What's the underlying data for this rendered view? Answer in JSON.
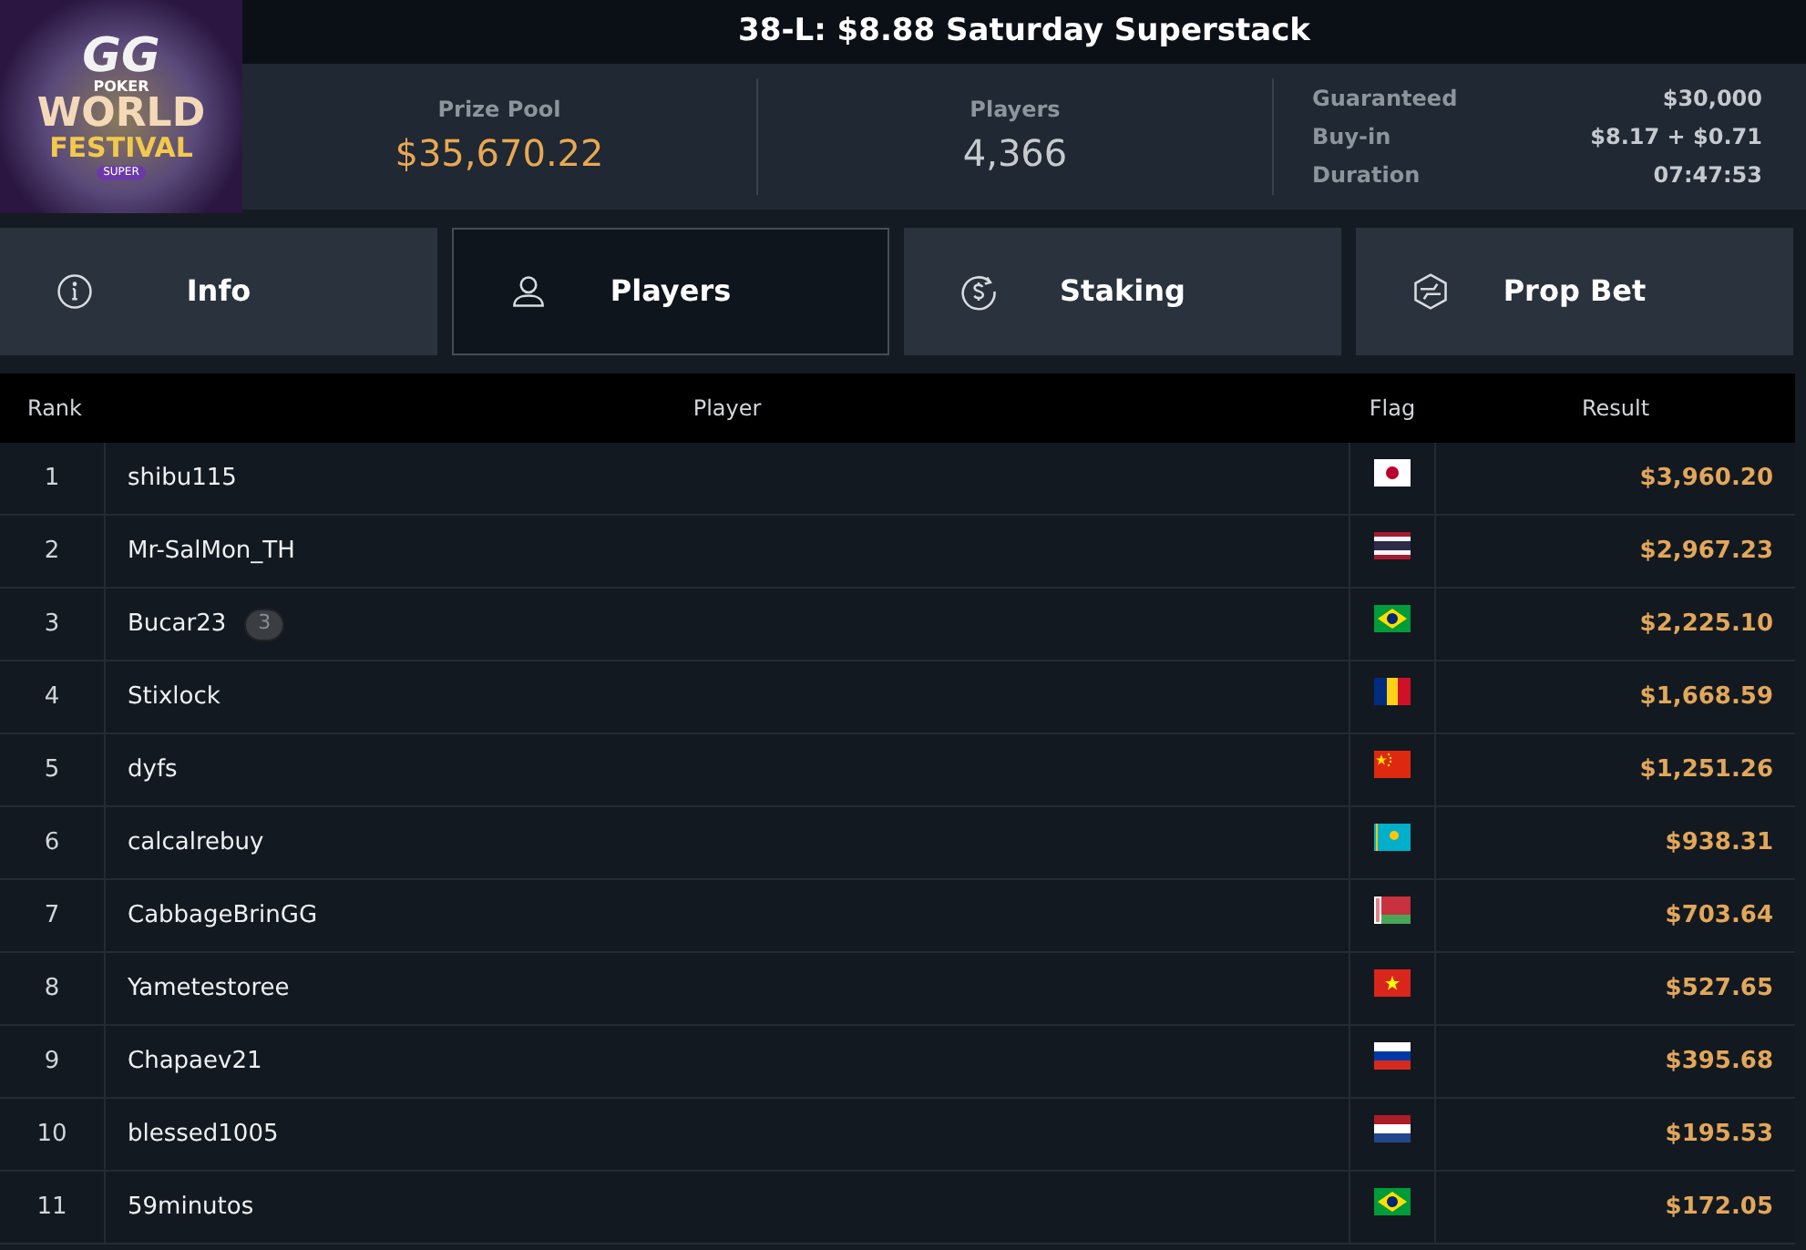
{
  "logo": {
    "brand": "GG",
    "sub": "POKER",
    "line1": "WORLD",
    "line2": "FESTIVAL",
    "badge": "SUPER"
  },
  "title": "38-L: $8.88 Saturday Superstack",
  "stats": [
    {
      "label": "Prize Pool",
      "value": "$35,670.22",
      "accent": true
    },
    {
      "label": "Players",
      "value": "4,366",
      "accent": false
    }
  ],
  "details": [
    {
      "label": "Guaranteed",
      "value": "$30,000"
    },
    {
      "label": "Buy-in",
      "value": "$8.17 + $0.71"
    },
    {
      "label": "Duration",
      "value": "07:47:53"
    }
  ],
  "tabs": [
    {
      "label": "Info",
      "kind": "info",
      "selected": false
    },
    {
      "label": "Players",
      "kind": "players",
      "selected": true
    },
    {
      "label": "Staking",
      "kind": "staking",
      "selected": false
    },
    {
      "label": "Prop Bet",
      "kind": "propbet",
      "selected": false
    }
  ],
  "table": {
    "columns": [
      "Rank",
      "Player",
      "Flag",
      "Result"
    ],
    "rows": [
      {
        "rank": "1",
        "player": "shibu115",
        "flag": {
          "kind": "jp"
        },
        "result": "$3,960.20"
      },
      {
        "rank": "2",
        "player": "Mr-SalMon_TH",
        "flag": {
          "kind": "th"
        },
        "result": "$2,967.23"
      },
      {
        "rank": "3",
        "player": "Bucar23",
        "badge": "3",
        "flag": {
          "kind": "br"
        },
        "result": "$2,225.10"
      },
      {
        "rank": "4",
        "player": "Stixlock",
        "flag": {
          "kind": "ro"
        },
        "result": "$1,668.59"
      },
      {
        "rank": "5",
        "player": "dyfs",
        "flag": {
          "kind": "cn"
        },
        "result": "$1,251.26"
      },
      {
        "rank": "6",
        "player": "calcalrebuy",
        "flag": {
          "kind": "kz"
        },
        "result": "$938.31"
      },
      {
        "rank": "7",
        "player": "CabbageBrinGG",
        "flag": {
          "kind": "by"
        },
        "result": "$703.64"
      },
      {
        "rank": "8",
        "player": "Yametestoree",
        "flag": {
          "kind": "vn"
        },
        "result": "$527.65"
      },
      {
        "rank": "9",
        "player": "Chapaev21",
        "flag": {
          "kind": "ru"
        },
        "result": "$395.68"
      },
      {
        "rank": "10",
        "player": "blessed1005",
        "flag": {
          "kind": "nl"
        },
        "result": "$195.53"
      },
      {
        "rank": "11",
        "player": "59minutos",
        "flag": {
          "kind": "br"
        },
        "result": "$172.05"
      }
    ]
  }
}
